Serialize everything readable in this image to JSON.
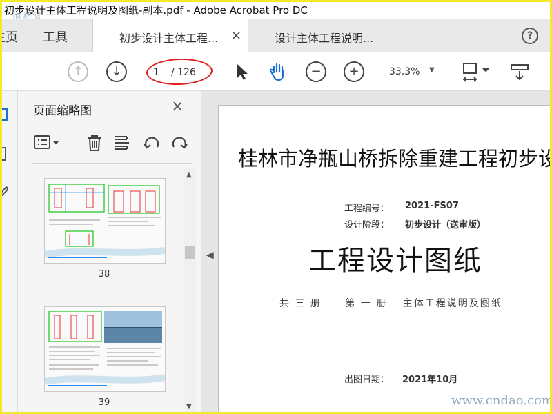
{
  "window": {
    "title": "初步设计主体工程说明及图纸-副本.pdf - Adobe Acrobat Pro DC"
  },
  "watermark": {
    "top_left": "道桥网",
    "bottom_right": "www.cndao.com"
  },
  "nav": {
    "home": "主页",
    "tools": "工具"
  },
  "tabs": [
    {
      "label": "初步设计主体工程...",
      "close": "×"
    },
    {
      "label": "设计主体工程说明..."
    }
  ],
  "help": {
    "label": "?"
  },
  "toolbar": {
    "page_current": "1",
    "page_total": "/ 126",
    "zoom": "33.3%"
  },
  "panel": {
    "title": "页面缩略图",
    "close": "×",
    "thumbnails": [
      {
        "label": "38"
      },
      {
        "label": "39"
      }
    ]
  },
  "document": {
    "title": "桂林市净瓶山桥拆除重建工程初步设",
    "project_no_label": "工程编号：",
    "project_no": "2021-FS07",
    "stage_label": "设计阶段：",
    "stage": "初步设计（送审版）",
    "main_title": "工程设计图纸",
    "volume_total": "共  三  册",
    "volume_no": "第  一  册",
    "volume_desc": "主体工程说明及图纸",
    "date_label": "出图日期：",
    "date": "2021年10月"
  },
  "colors": {
    "highlight_oval": "#e02020",
    "frame": "#f2ea2a",
    "accent": "#1a6fd6"
  }
}
